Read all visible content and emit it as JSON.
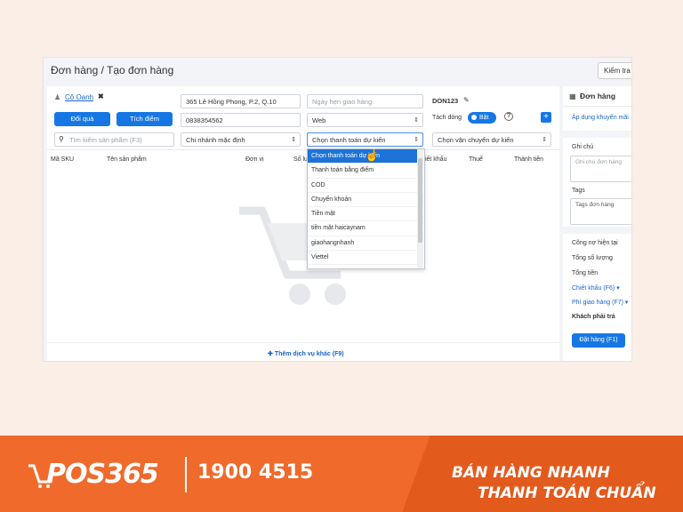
{
  "header": {
    "breadcrumb": "Đơn hàng / Tạo đơn hàng",
    "check_button": "Kiểm tra tồn"
  },
  "customer": {
    "name": "Cô Oanh",
    "gift_button": "Đổi quà",
    "points_button": "Tích điểm",
    "address": "365 Lê Hồng Phong, P.2, Q.10",
    "phone": "0838354562",
    "product_search_placeholder": "Tìm kiếm sản phẩm (F3)"
  },
  "order": {
    "delivery_date_placeholder": "Ngày hẹn giao hàng",
    "channel": "Web",
    "branch": "Chi nhánh mặc định",
    "payment_select": "Chọn thanh toán dự kiến",
    "shipping_select": "Chọn vận chuyển dự kiến",
    "order_code": "DON123",
    "split_label": "Tách dòng",
    "split_toggle": "Bật",
    "add_button": "+"
  },
  "table": {
    "columns": [
      "Mã SKU",
      "Tên sản phẩm",
      "Đơn vị",
      "Số lượng",
      "Chiết khấu",
      "Thuế",
      "Thành tiền"
    ]
  },
  "payment_options": [
    "Chọn thanh toán dự kiến",
    "Thanh toán bằng điểm",
    "COD",
    "Chuyển khoản",
    "Tiền mặt",
    "tiền mặt haicaynam",
    "giaohangnhanh",
    "Viettel"
  ],
  "add_service": "Thêm dịch vụ khác (F9)",
  "sidebar": {
    "order_title": "Đơn hàng",
    "promo_link": "Áp dụng khuyến mãi",
    "note_label": "Ghi chú",
    "note_placeholder": "Ghi chú đơn hàng",
    "tags_label": "Tags",
    "tags_placeholder": "Tags đơn hàng",
    "debt": "Công nợ hiện tại",
    "total_qty": "Tổng số lượng",
    "total_amount": "Tổng tiền",
    "discount": "Chiết khấu (F6)",
    "shipping_fee": "Phí giao hàng (F7)",
    "customer_pays": "Khách phải trả",
    "submit": "Đặt hàng (F1)"
  },
  "banner": {
    "logo": "POS365",
    "hotline": "1900 4515",
    "slogan_1": "BÁN HÀNG NHANH",
    "slogan_2": "THANH TOÁN CHUẨN"
  }
}
